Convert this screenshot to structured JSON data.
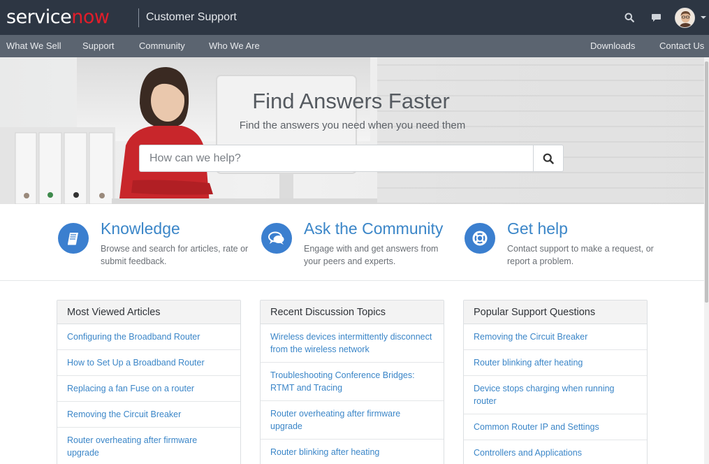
{
  "header": {
    "logo_part1": "service",
    "logo_part2": "now",
    "portal_title": "Customer Support",
    "brand_color": "#e11d2a",
    "icons": [
      "search-icon",
      "chat-icon",
      "avatar",
      "caret-down-icon"
    ]
  },
  "nav": {
    "left": [
      "What We Sell",
      "Support",
      "Community",
      "Who We Are"
    ],
    "right": [
      "Downloads",
      "Contact Us"
    ]
  },
  "hero": {
    "title": "Find Answers Faster",
    "subtitle": "Find the answers you need when you need them",
    "search_placeholder": "How can we help?"
  },
  "features": [
    {
      "icon": "book-icon",
      "title": "Knowledge",
      "desc": "Browse and search for articles, rate or submit feedback."
    },
    {
      "icon": "chat-bubbles-icon",
      "title": "Ask the Community",
      "desc": "Engage with and get answers from your peers and experts."
    },
    {
      "icon": "lifebuoy-icon",
      "title": "Get help",
      "desc": "Contact support to make a request, or report a problem."
    }
  ],
  "panels": [
    {
      "title": "Most Viewed Articles",
      "items": [
        "Configuring the Broadband Router",
        "How to Set Up a Broadband Router",
        "Replacing a fan Fuse on a router",
        "Removing the Circuit Breaker",
        "Router overheating after firmware upgrade"
      ]
    },
    {
      "title": "Recent Discussion Topics",
      "items": [
        "Wireless devices intermittently disconnect from the wireless network",
        "Troubleshooting Conference Bridges: RTMT and Tracing",
        "Router overheating after firmware upgrade",
        "Router blinking after heating"
      ]
    },
    {
      "title": "Popular Support Questions",
      "items": [
        "Removing the Circuit Breaker",
        "Router blinking after heating",
        "Device stops charging when running router",
        "Common Router IP and Settings",
        "Controllers and Applications"
      ]
    }
  ],
  "colors": {
    "header_bg": "#2d3643",
    "nav_bg": "#5b6470",
    "link": "#3b86c8",
    "icon_circle": "#3b7fcf"
  }
}
